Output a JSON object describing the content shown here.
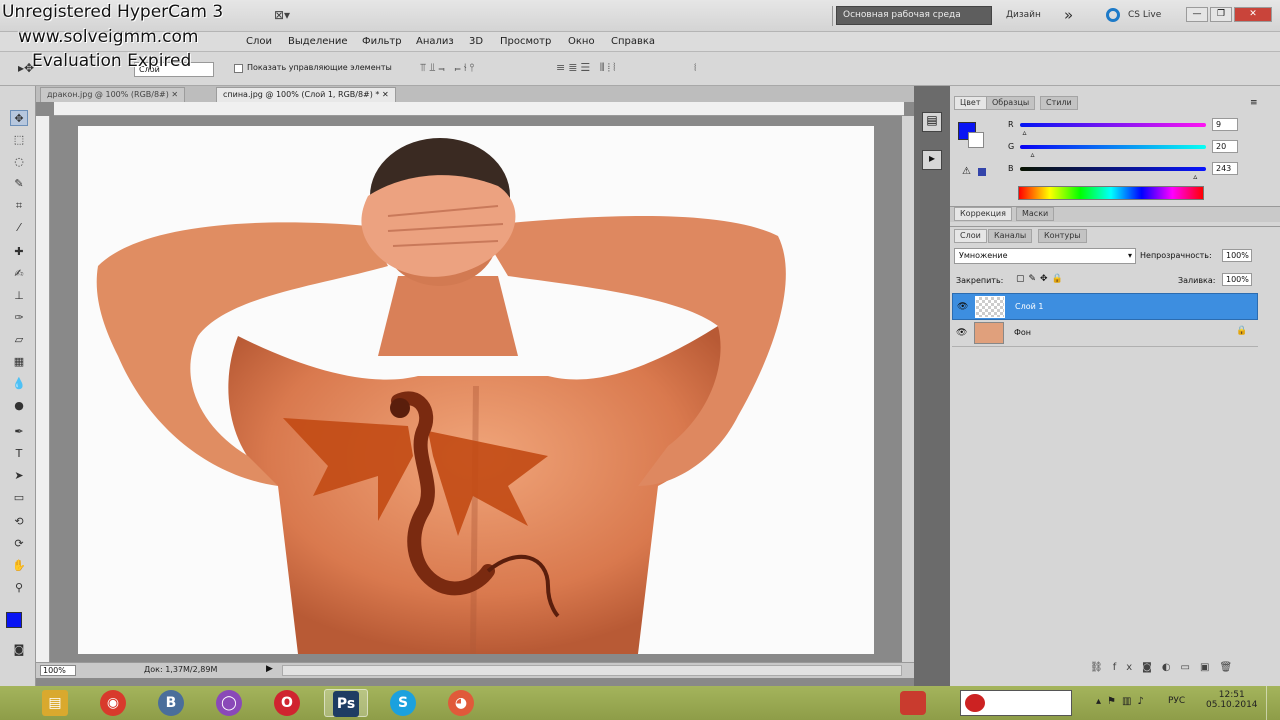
{
  "watermark": {
    "line1": "Unregistered HyperCam 3",
    "line2": "www.solveigmm.com",
    "line3": "Evaluation Expired"
  },
  "appbar": {
    "workspace_button": "Основная рабочая среда",
    "design_label": "Дизайн",
    "more": "»",
    "cslive": "CS Live"
  },
  "menu": [
    "Слои",
    "Выделение",
    "Фильтр",
    "Анализ",
    "3D",
    "Просмотр",
    "Окно",
    "Справка"
  ],
  "options": {
    "auto_select_value": "Слой",
    "show_controls_label": "Показать управляющие элементы"
  },
  "tabs": [
    {
      "label": "дракон.jpg @ 100% (RGB/8#)"
    },
    {
      "label": "спина.jpg @ 100% (Слой 1, RGB/8#) *"
    }
  ],
  "status": {
    "zoom": "100%",
    "doc": "Док: 1,37M/2,89M"
  },
  "color_panel": {
    "tabs": [
      "Цвет",
      "Образцы",
      "Стили"
    ],
    "r_label": "R",
    "g_label": "G",
    "b_label": "B",
    "r": "9",
    "g": "20",
    "b": "243",
    "r_frac": 0.035,
    "g_frac": 0.078,
    "b_frac": 0.953,
    "fg_color": "#0914f3"
  },
  "adjust_tabs": [
    "Коррекция",
    "Маски"
  ],
  "layers_panel": {
    "tabs": [
      "Слои",
      "Каналы",
      "Контуры"
    ],
    "blend_mode": "Умножение",
    "opacity_label": "Непрозрачность:",
    "opacity_value": "100%",
    "lock_label": "Закрепить:",
    "fill_label": "Заливка:",
    "fill_value": "100%",
    "layers": [
      {
        "name": "Слой 1",
        "selected": true
      },
      {
        "name": "Фон",
        "selected": false
      }
    ]
  },
  "taskbar": {
    "apps": [
      {
        "icon": "explorer-icon",
        "color": "#d9a92e",
        "glyph": "▤"
      },
      {
        "icon": "chrome-icon",
        "color": "#d83a2c",
        "glyph": "◉"
      },
      {
        "icon": "vk-icon",
        "color": "#4a6e9b",
        "glyph": "B"
      },
      {
        "icon": "circle-app-icon",
        "color": "#8a49b8",
        "glyph": "◯"
      },
      {
        "icon": "opera-icon",
        "color": "#d0242f",
        "glyph": "O"
      },
      {
        "icon": "photoshop-icon",
        "color": "#1e3d63",
        "glyph": "Ps"
      },
      {
        "icon": "skype-icon",
        "color": "#1ba1de",
        "glyph": "S"
      },
      {
        "icon": "picasa-icon",
        "color": "#e05a3a",
        "glyph": "◕"
      }
    ],
    "lang": "РУС",
    "time": "12:51",
    "date": "05.10.2014"
  }
}
